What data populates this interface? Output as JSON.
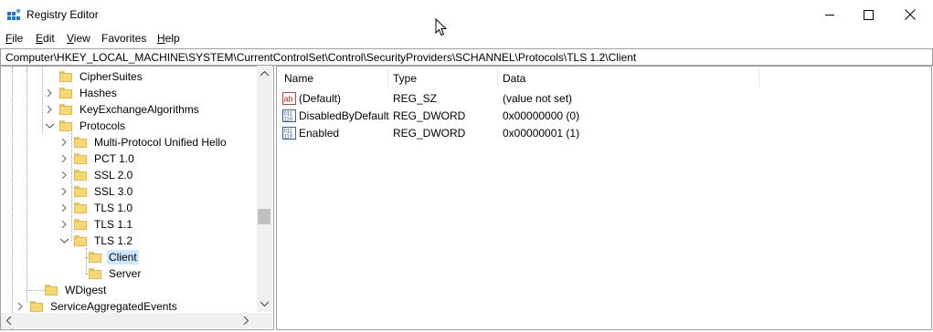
{
  "window": {
    "title": "Registry Editor"
  },
  "menu": [
    {
      "label": "File",
      "key": "F",
      "rest": "ile"
    },
    {
      "label": "Edit",
      "key": "E",
      "rest": "dit"
    },
    {
      "label": "View",
      "key": "V",
      "rest": "iew"
    },
    {
      "label": "Favorites",
      "key": "",
      "rest": "Favorites"
    },
    {
      "label": "Help",
      "key": "H",
      "rest": "elp"
    }
  ],
  "address": "Computer\\HKEY_LOCAL_MACHINE\\SYSTEM\\CurrentControlSet\\Control\\SecurityProviders\\SCHANNEL\\Protocols\\TLS 1.2\\Client",
  "tree": [
    {
      "label": "CipherSuites",
      "expander": "none"
    },
    {
      "label": "Hashes",
      "expander": "collapsed"
    },
    {
      "label": "KeyExchangeAlgorithms",
      "expander": "collapsed"
    },
    {
      "label": "Protocols",
      "expander": "expanded"
    },
    {
      "label": "Multi-Protocol Unified Hello",
      "expander": "collapsed"
    },
    {
      "label": "PCT 1.0",
      "expander": "collapsed"
    },
    {
      "label": "SSL 2.0",
      "expander": "collapsed"
    },
    {
      "label": "SSL 3.0",
      "expander": "collapsed"
    },
    {
      "label": "TLS 1.0",
      "expander": "collapsed"
    },
    {
      "label": "TLS 1.1",
      "expander": "collapsed"
    },
    {
      "label": "TLS 1.2",
      "expander": "expanded"
    },
    {
      "label": "Client",
      "expander": "none",
      "selected": true
    },
    {
      "label": "Server",
      "expander": "none"
    },
    {
      "label": "WDigest",
      "expander": "none"
    },
    {
      "label": "ServiceAggregatedEvents",
      "expander": "collapsed"
    }
  ],
  "list": {
    "columns": {
      "name": "Name",
      "type": "Type",
      "data": "Data"
    },
    "rows": [
      {
        "name": "(Default)",
        "type": "REG_SZ",
        "data": "(value not set)",
        "icon": "string-value-icon"
      },
      {
        "name": "DisabledByDefault",
        "type": "REG_DWORD",
        "data": "0x00000000 (0)",
        "icon": "binary-value-icon"
      },
      {
        "name": "Enabled",
        "type": "REG_DWORD",
        "data": "0x00000001 (1)",
        "icon": "binary-value-icon"
      }
    ]
  },
  "colors": {
    "selection": "#cce8ff",
    "folder": "#f8d775",
    "border": "#a0a0a0"
  }
}
